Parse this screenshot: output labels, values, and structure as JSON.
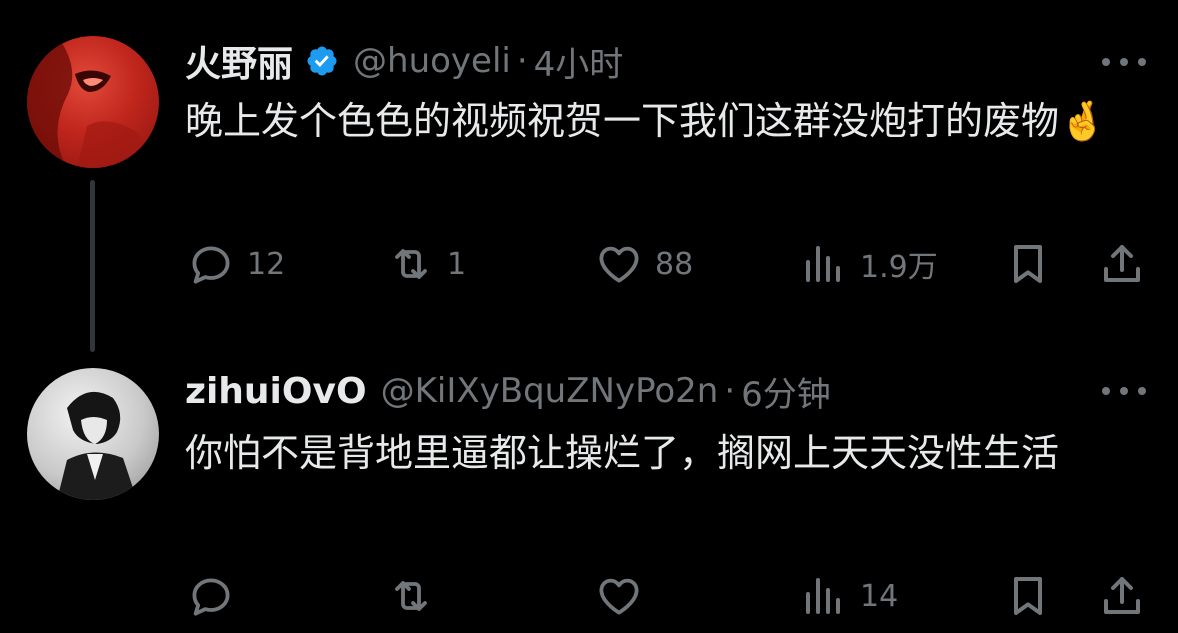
{
  "tweets": [
    {
      "display_name": "火野丽",
      "verified": true,
      "handle": "@huoyeli",
      "separator": "·",
      "time": "4小时",
      "text": "晚上发个色色的视频祝贺一下我们这群没炮打的废物🤞",
      "replies": "12",
      "retweets": "1",
      "likes": "88",
      "views": "1.9万"
    },
    {
      "display_name": "zihuiOvO",
      "verified": false,
      "handle": "@KiIXyBquZNyPo2n",
      "separator": "·",
      "time": "6分钟",
      "text": "你怕不是背地里逼都让操烂了，搁网上天天没性生活",
      "replies": "",
      "retweets": "",
      "likes": "",
      "views": "14"
    }
  ],
  "icons": {
    "reply": "reply-icon",
    "retweet": "retweet-icon",
    "like": "heart-icon",
    "views": "views-chart-icon",
    "bookmark": "bookmark-icon",
    "share": "share-icon",
    "more": "more-dots-icon",
    "verified": "verified-badge-icon"
  },
  "colors": {
    "background": "#000000",
    "text": "#e7e9ea",
    "secondary": "#71767b",
    "verified": "#1d9bf0"
  }
}
